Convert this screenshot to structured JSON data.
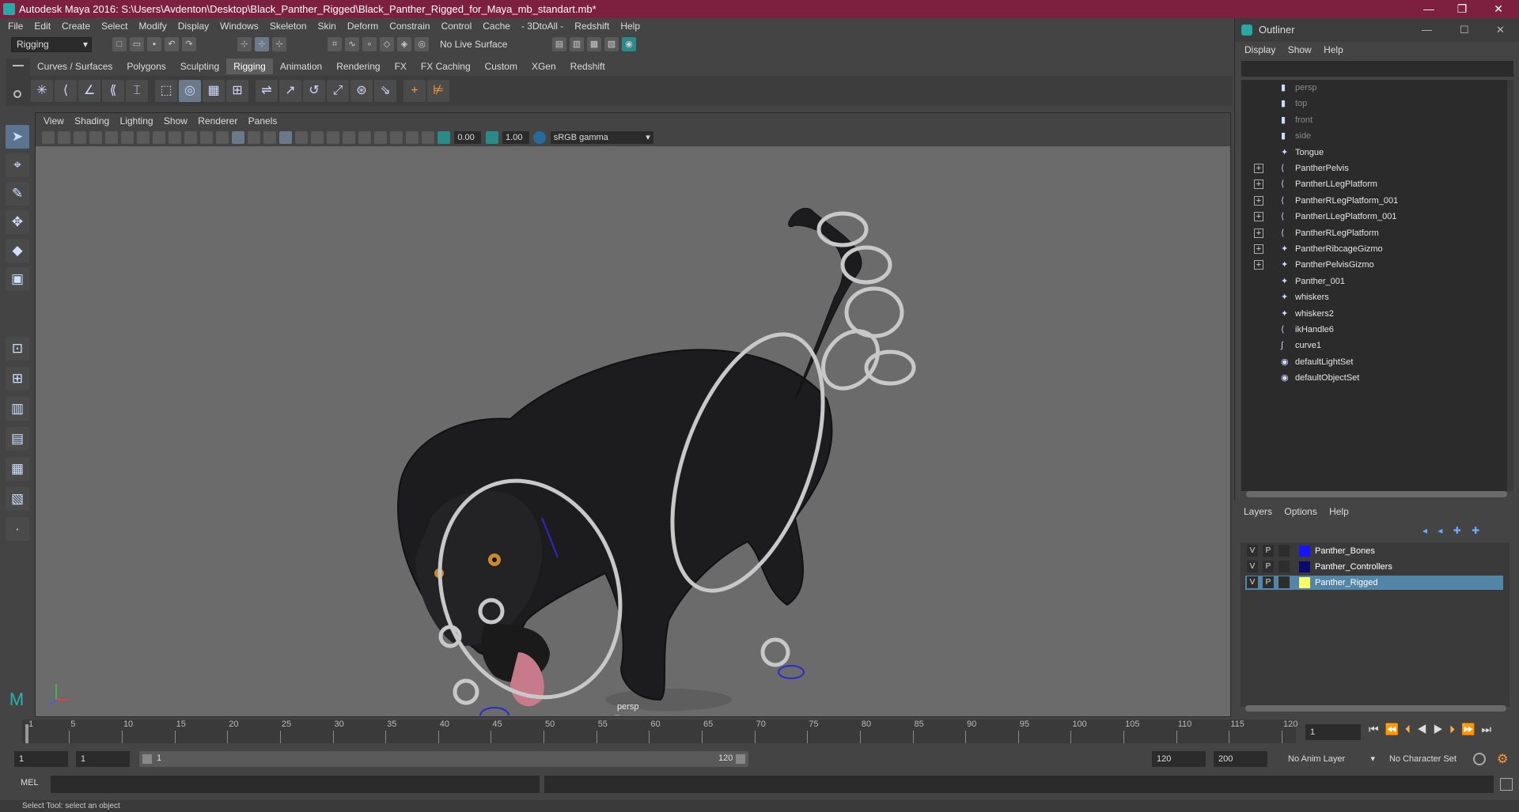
{
  "window": {
    "title": "Autodesk Maya 2016: S:\\Users\\Avdenton\\Desktop\\Black_Panther_Rigged\\Black_Panther_Rigged_for_Maya_mb_standart.mb*",
    "minimize": "—",
    "restore": "❐",
    "close": "✕"
  },
  "menubar": [
    "File",
    "Edit",
    "Create",
    "Select",
    "Modify",
    "Display",
    "Windows",
    "Skeleton",
    "Skin",
    "Deform",
    "Constrain",
    "Control",
    "Cache",
    "- 3DtoAll -",
    "Redshift",
    "Help"
  ],
  "statusline": {
    "menuset": "Rigging",
    "live_surface": "No Live Surface"
  },
  "shelf": {
    "tabs": [
      "Curves / Surfaces",
      "Polygons",
      "Sculpting",
      "Rigging",
      "Animation",
      "Rendering",
      "FX",
      "FX Caching",
      "Custom",
      "XGen",
      "Redshift"
    ],
    "active_tab": "Rigging"
  },
  "viewport": {
    "menu": [
      "View",
      "Shading",
      "Lighting",
      "Show",
      "Renderer",
      "Panels"
    ],
    "exposure": "0.00",
    "gamma": "1.00",
    "color_space": "sRGB gamma",
    "camera_label": "persp"
  },
  "outliner": {
    "title": "Outliner",
    "menu": [
      "Display",
      "Show",
      "Help"
    ],
    "items": [
      {
        "label": "persp",
        "icon": "camera-icon",
        "expandable": false,
        "dim": true
      },
      {
        "label": "top",
        "icon": "camera-icon",
        "expandable": false,
        "dim": true
      },
      {
        "label": "front",
        "icon": "camera-icon",
        "expandable": false,
        "dim": true
      },
      {
        "label": "side",
        "icon": "camera-icon",
        "expandable": false,
        "dim": true
      },
      {
        "label": "Tongue",
        "icon": "mesh-icon",
        "expandable": false,
        "dim": false
      },
      {
        "label": "PantherPelvis",
        "icon": "joint-icon",
        "expandable": true,
        "dim": false
      },
      {
        "label": "PantherLLegPlatform",
        "icon": "joint-icon",
        "expandable": true,
        "dim": false
      },
      {
        "label": "PantherRLegPlatform_001",
        "icon": "joint-icon",
        "expandable": true,
        "dim": false
      },
      {
        "label": "PantherLLegPlatform_001",
        "icon": "joint-icon",
        "expandable": true,
        "dim": false
      },
      {
        "label": "PantherRLegPlatform",
        "icon": "joint-icon",
        "expandable": true,
        "dim": false
      },
      {
        "label": "PantherRibcageGizmo",
        "icon": "mesh-icon",
        "expandable": true,
        "dim": false
      },
      {
        "label": "PantherPelvisGizmo",
        "icon": "mesh-icon",
        "expandable": true,
        "dim": false
      },
      {
        "label": "Panther_001",
        "icon": "mesh-icon",
        "expandable": false,
        "dim": false
      },
      {
        "label": "whiskers",
        "icon": "mesh-icon",
        "expandable": false,
        "dim": false
      },
      {
        "label": "whiskers2",
        "icon": "mesh-icon",
        "expandable": false,
        "dim": false
      },
      {
        "label": "ikHandle6",
        "icon": "ik-handle-icon",
        "expandable": false,
        "dim": false
      },
      {
        "label": "curve1",
        "icon": "curve-icon",
        "expandable": false,
        "dim": false
      },
      {
        "label": "defaultLightSet",
        "icon": "set-icon",
        "expandable": false,
        "dim": false
      },
      {
        "label": "defaultObjectSet",
        "icon": "set-icon",
        "expandable": false,
        "dim": false
      }
    ]
  },
  "layers": {
    "menu": [
      "Layers",
      "Options",
      "Help"
    ],
    "rows": [
      {
        "v": "V",
        "p": "P",
        "name": "Panther_Bones",
        "color": "#1414ff",
        "selected": false
      },
      {
        "v": "V",
        "p": "P",
        "name": "Panther_Controllers",
        "color": "#0a0a6e",
        "selected": false
      },
      {
        "v": "V",
        "p": "P",
        "name": "Panther_Rigged",
        "color": "#ffff66",
        "selected": true
      }
    ]
  },
  "timeline": {
    "ticks": [
      "1",
      "5",
      "10",
      "15",
      "20",
      "25",
      "30",
      "35",
      "40",
      "45",
      "50",
      "55",
      "60",
      "65",
      "70",
      "75",
      "80",
      "85",
      "90",
      "95",
      "100",
      "105",
      "110",
      "115",
      "120"
    ],
    "current_frame": "1"
  },
  "range": {
    "start": "1",
    "playback_start": "1",
    "slider_start": "1",
    "slider_end": "120",
    "playback_end": "120",
    "end": "200",
    "anim_layer": "No Anim Layer",
    "char_set": "No Character Set"
  },
  "mel": {
    "label": "MEL"
  },
  "helpline": "Select Tool: select an object"
}
